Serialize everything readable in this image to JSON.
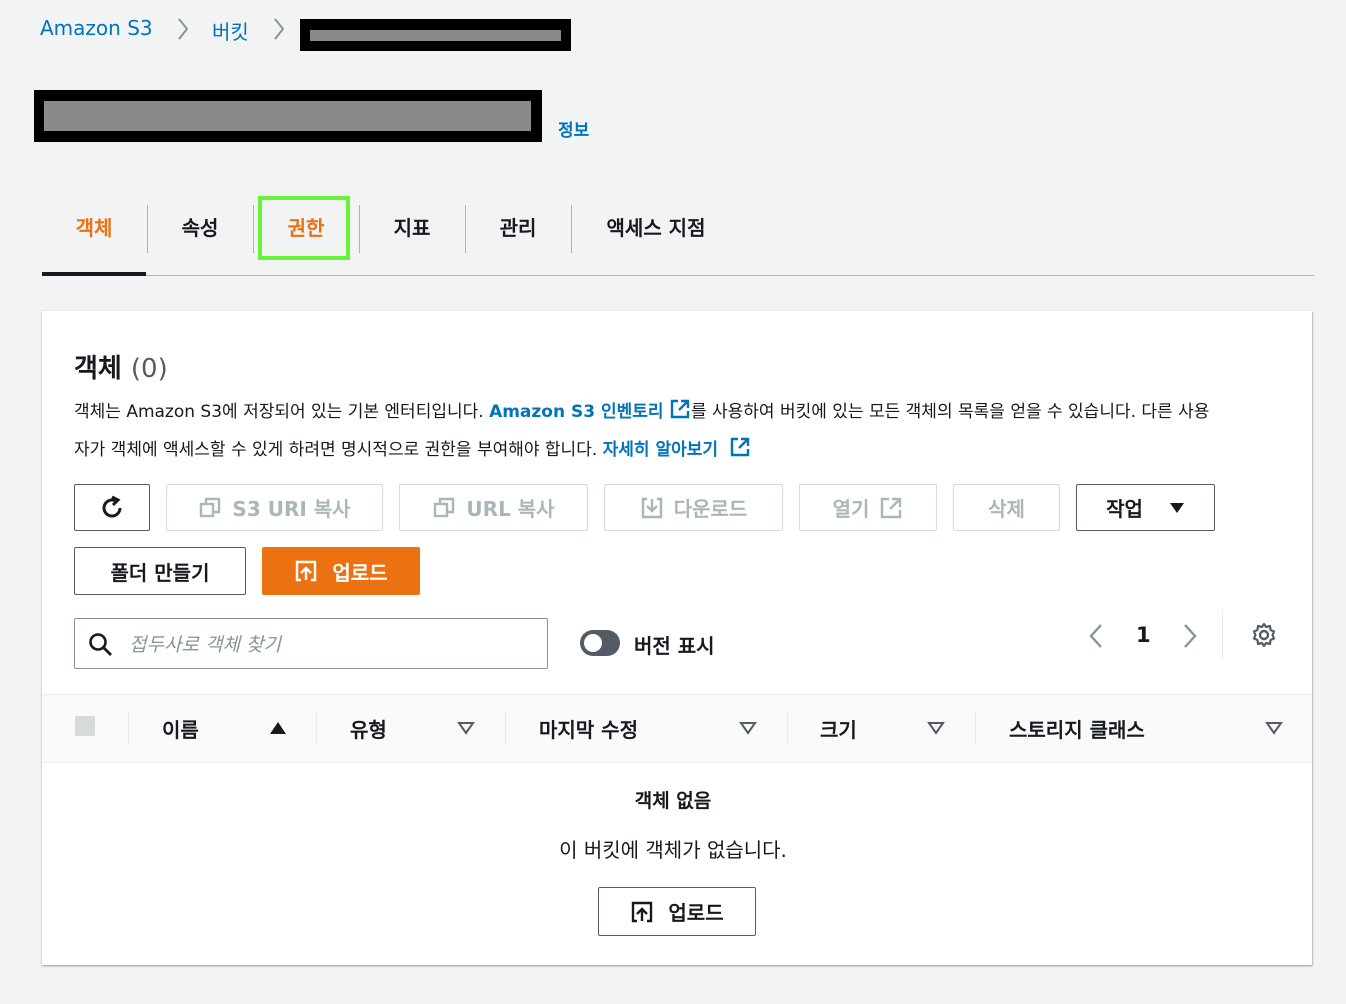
{
  "breadcrumb": {
    "items": [
      "Amazon S3",
      "버킷"
    ],
    "separator": ">"
  },
  "header": {
    "info_link": "정보"
  },
  "tabs": [
    {
      "label": "객체",
      "active": true
    },
    {
      "label": "속성",
      "active": false
    },
    {
      "label": "권한",
      "active": false,
      "highlighted": true
    },
    {
      "label": "지표",
      "active": false
    },
    {
      "label": "관리",
      "active": false
    },
    {
      "label": "액세스 지점",
      "active": false
    }
  ],
  "objects_panel": {
    "title": "객체",
    "count": "(0)",
    "description": {
      "part1": "객체는 Amazon S3에 저장되어 있는 기본 엔터티입니다. ",
      "link1": "Amazon S3 인벤토리",
      "part2": "를 사용하여 버킷에 있는 모든 객체의 목록을 얻을 수 있습니다. 다른 사용",
      "part3": "자가 객체에 액세스할 수 있게 하려면 명시적으로 권한을 부여해야 합니다. ",
      "link2": "자세히 알아보기"
    },
    "buttons": {
      "refresh": "refresh-icon",
      "copy_s3_uri": "S3 URI 복사",
      "copy_url": "URL 복사",
      "download": "다운로드",
      "open": "열기",
      "delete": "삭제",
      "actions": "작업",
      "create_folder": "폴더 만들기",
      "upload": "업로드"
    },
    "search": {
      "placeholder": "접두사로 객체 찾기",
      "value": ""
    },
    "show_versions": {
      "label": "버전 표시",
      "enabled": false
    },
    "pagination": {
      "page": "1"
    },
    "table": {
      "columns": [
        "이름",
        "유형",
        "마지막 수정",
        "크기",
        "스토리지 클래스"
      ]
    },
    "empty_state": {
      "title": "객체 없음",
      "description": "이 버킷에 객체가 없습니다.",
      "upload_button": "업로드"
    }
  },
  "colors": {
    "accent": "#ec7211",
    "link": "#0073bb",
    "highlight": "#67f33a"
  }
}
